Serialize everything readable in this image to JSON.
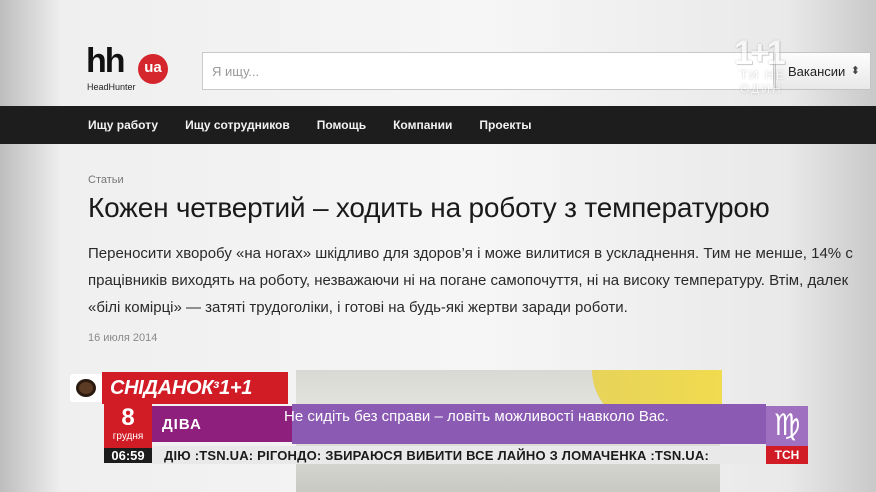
{
  "site": {
    "logo_main": "hh",
    "logo_badge": "ua",
    "logo_sub": "HeadHunter",
    "search_placeholder": "Я ищу...",
    "search_scope": "Вакансии"
  },
  "nav": {
    "items": [
      "Ищу работу",
      "Ищу сотрудников",
      "Помощь",
      "Компании",
      "Проекты"
    ]
  },
  "article": {
    "breadcrumb": "Статьи",
    "title": "Кожен четвертий – ходить на роботу з температурою",
    "lead_lines": [
      "Переносити хворобу «на ногах» шкідливо для здоров’я і може вилитися в ускладнення. Тим не менше, 14% с",
      "працівників виходять на роботу, незважаючи ні на погане самопочуття, ні на високу температуру. Втім, далек",
      "«білі комірці» — затяті трудоголіки, і готові на будь-які жертви заради роботи."
    ],
    "date": "16 июля 2014"
  },
  "tv": {
    "channel_big": "1+1",
    "channel_small": "ТИ НЕ ОДИН",
    "show_name": "СНІДАНОК",
    "show_with": "з",
    "show_channel": "1+1",
    "day": "8",
    "month": "грудня",
    "time": "06:59",
    "topic": "ДІВА",
    "message": "Не сидіть без справи – ловіть можливості навколо Вас.",
    "zodiac_symbol": "♍",
    "news_badge": "ТСН",
    "ticker": "ДІЮ  :TSN.UA:  РІГОНДО: ЗБИРАЮСЯ ВИБИТИ ВСЕ ЛАЙНО З ЛОМАЧЕНКА  :TSN.UA:"
  },
  "colors": {
    "brand_red": "#d11c26",
    "nav_bg": "#1d1d1d",
    "purple_bar": "#8b5ab3",
    "topic_bg": "#8f1f7c"
  }
}
